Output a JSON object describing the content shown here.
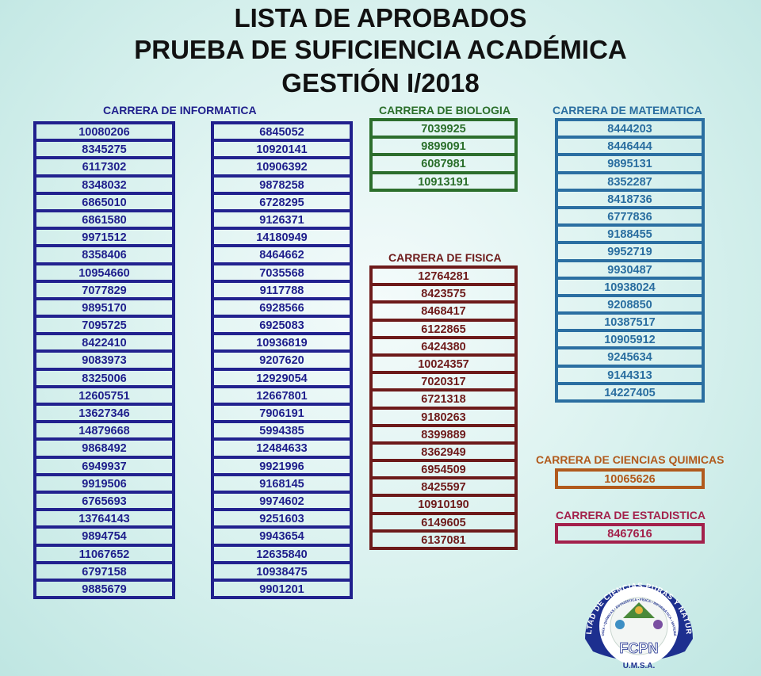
{
  "title": {
    "line1": "LISTA DE APROBADOS",
    "line2": "PRUEBA DE SUFICIENCIA  ACADÉMICA",
    "line3": "GESTIÓN I/2018"
  },
  "informatica": {
    "heading": "CARRERA DE INFORMATICA",
    "col1": [
      "10080206",
      "8345275",
      "6117302",
      "8348032",
      "6865010",
      "6861580",
      "9971512",
      "8358406",
      "10954660",
      "7077829",
      "9895170",
      "7095725",
      "8422410",
      "9083973",
      "8325006",
      "12605751",
      "13627346",
      "14879668",
      "9868492",
      "6949937",
      "9919506",
      "6765693",
      "13764143",
      "9894754",
      "11067652",
      "6797158",
      "9885679"
    ],
    "col2": [
      "6845052",
      "10920141",
      "10906392",
      "9878258",
      "6728295",
      "9126371",
      "14180949",
      "8464662",
      "7035568",
      "9117788",
      "6928566",
      "6925083",
      "10936819",
      "9207620",
      "12929054",
      "12667801",
      "7906191",
      "5994385",
      "12484633",
      "9921996",
      "9168145",
      "9974602",
      "9251603",
      "9943654",
      "12635840",
      "10938475",
      "9901201"
    ]
  },
  "biologia": {
    "heading": "CARRERA DE BIOLOGIA",
    "items": [
      "7039925",
      "9899091",
      "6087981",
      "10913191"
    ]
  },
  "fisica": {
    "heading": "CARRERA DE FISICA",
    "items": [
      "12764281",
      "8423575",
      "8468417",
      "6122865",
      "6424380",
      "10024357",
      "7020317",
      "6721318",
      "9180263",
      "8399889",
      "8362949",
      "6954509",
      "8425597",
      "10910190",
      "6149605",
      "6137081"
    ]
  },
  "matematica": {
    "heading": "CARRERA DE MATEMATICA",
    "items": [
      "8444203",
      "8446444",
      "9895131",
      "8352287",
      "8418736",
      "6777836",
      "9188455",
      "9952719",
      "9930487",
      "10938024",
      "9208850",
      "10387517",
      "10905912",
      "9245634",
      "9144313",
      "14227405"
    ]
  },
  "quimicas": {
    "heading": "CARRERA DE CIENCIAS QUIMICAS",
    "items": [
      "10065626"
    ]
  },
  "estadistica": {
    "heading": "CARRERA DE ESTADISTICA",
    "items": [
      "8467616"
    ]
  },
  "logo": {
    "ring_text": "FACULTAD DE CIENCIAS PURAS Y NATURALES",
    "inner_text": "BIOLOGÍA • QUÍMICAS • ESTADÍSTICA • FÍSICA • INFORMÁTICA • MATEMÁTICA",
    "acronym": "FCPN",
    "university": "U.M.S.A."
  }
}
